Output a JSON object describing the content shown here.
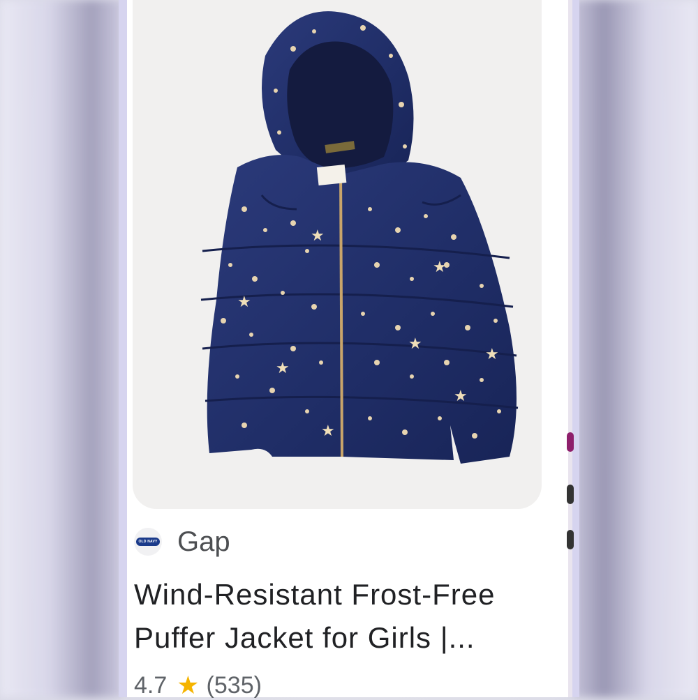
{
  "product": {
    "image_alt": "Navy puffer jacket with gold stars",
    "source_logo_text": "OLD NAVY",
    "source_name": "Gap",
    "title_line1": "Wind-Resistant Frost-Free",
    "title_line2": "Puffer Jacket for Girls |...",
    "rating": "4.7",
    "review_count": "(535)"
  },
  "colors": {
    "jacket": "#23326b",
    "star_rating": "#f5b400",
    "accent_magenta": "#8e1f6b"
  },
  "icons": {
    "rating_star": "★"
  }
}
